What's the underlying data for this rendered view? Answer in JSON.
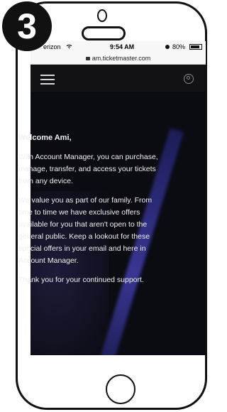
{
  "step": {
    "number": "3"
  },
  "status_bar": {
    "carrier": "erizon",
    "time": "9:54 AM",
    "battery": "80%"
  },
  "browser": {
    "url": "am.ticketmaster.com"
  },
  "content": {
    "greeting": "Welcome Ami,",
    "paragraphs": [
      "With Account Manager, you can purchase, manage, transfer, and access your tickets from any device.",
      "We value you as part of our family. From time to time we have exclusive offers available for you that aren't open to the general public. Keep a lookout for these special offers in your email and here in Account Manager.",
      "Thank you for your continued support."
    ]
  },
  "icons": {
    "menu": "hamburger-menu-icon",
    "account": "account-icon",
    "wifi": "wifi-icon",
    "alarm": "alarm-icon",
    "battery": "battery-icon",
    "lock": "lock-icon"
  }
}
